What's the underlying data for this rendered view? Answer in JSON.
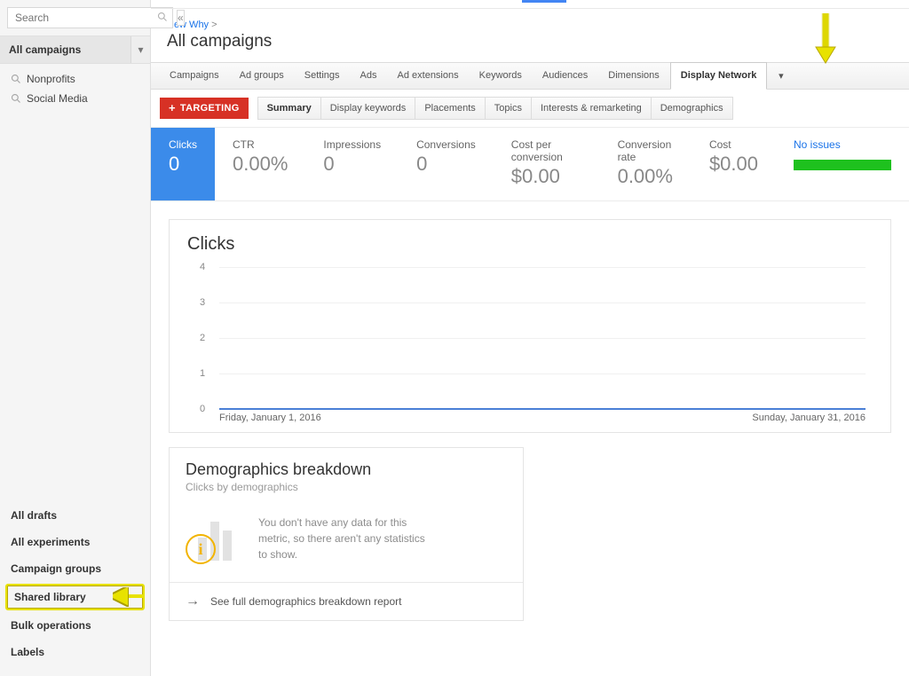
{
  "sidebar": {
    "search_placeholder": "Search",
    "all_campaigns": "All campaigns",
    "campaigns": [
      "Nonprofits",
      "Social Media"
    ],
    "lower_links": [
      "All drafts",
      "All experiments",
      "Campaign groups",
      "Shared library",
      "Bulk operations",
      "Labels"
    ]
  },
  "breadcrumb": {
    "root": "New Why",
    "sep": ">"
  },
  "page_title": "All campaigns",
  "tabs": [
    "Campaigns",
    "Ad groups",
    "Settings",
    "Ads",
    "Ad extensions",
    "Keywords",
    "Audiences",
    "Dimensions",
    "Display Network"
  ],
  "active_tab": "Display Network",
  "targeting_button": "TARGETING",
  "subtabs": [
    "Summary",
    "Display keywords",
    "Placements",
    "Topics",
    "Interests & remarketing",
    "Demographics"
  ],
  "active_subtab": "Summary",
  "metrics": [
    {
      "label": "Clicks",
      "value": "0",
      "active": true
    },
    {
      "label": "CTR",
      "value": "0.00%"
    },
    {
      "label": "Impressions",
      "value": "0"
    },
    {
      "label": "Conversions",
      "value": "0"
    },
    {
      "label": "Cost per conversion",
      "value": "$0.00"
    },
    {
      "label": "Conversion rate",
      "value": "0.00%"
    },
    {
      "label": "Cost",
      "value": "$0.00"
    }
  ],
  "status": {
    "text": "No issues"
  },
  "chart_data": {
    "type": "line",
    "title": "Clicks",
    "x": [
      "Friday, January 1, 2016",
      "Sunday, January 31, 2016"
    ],
    "yticks": [
      0,
      1,
      2,
      3,
      4
    ],
    "series": [
      {
        "name": "Clicks",
        "values": [
          0,
          0
        ]
      }
    ],
    "ylim": [
      0,
      4
    ],
    "xlabel": "",
    "ylabel": ""
  },
  "demographics": {
    "title": "Demographics breakdown",
    "subtitle": "Clicks by demographics",
    "empty_text": "You don't have any data for this metric, so there aren't any statistics to show.",
    "footer": "See full demographics breakdown report"
  }
}
